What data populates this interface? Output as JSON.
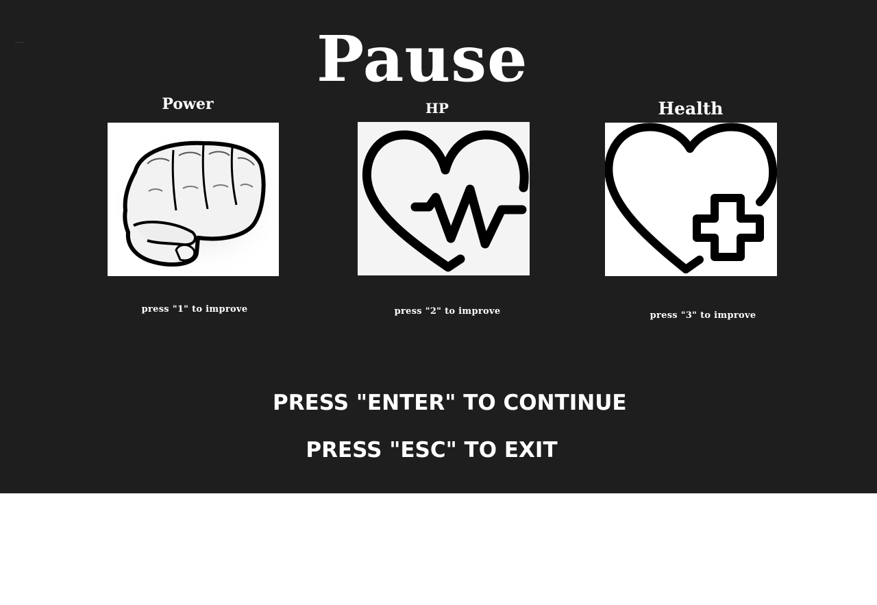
{
  "screen": {
    "background_color": "#1e1e1e",
    "title": "Pause"
  },
  "upgrades": [
    {
      "label": "Power",
      "icon": "fist-icon",
      "hint": "press \"1\" to improve"
    },
    {
      "label": "HP",
      "icon": "heart-pulse-icon",
      "hint": "press \"2\" to improve"
    },
    {
      "label": "Health",
      "icon": "heart-plus-icon",
      "hint": "press \"3\" to improve"
    }
  ],
  "prompts": {
    "continue": "PRESS \"ENTER\" TO CONTINUE",
    "exit": "PRESS \"ESC\" TO EXIT"
  }
}
